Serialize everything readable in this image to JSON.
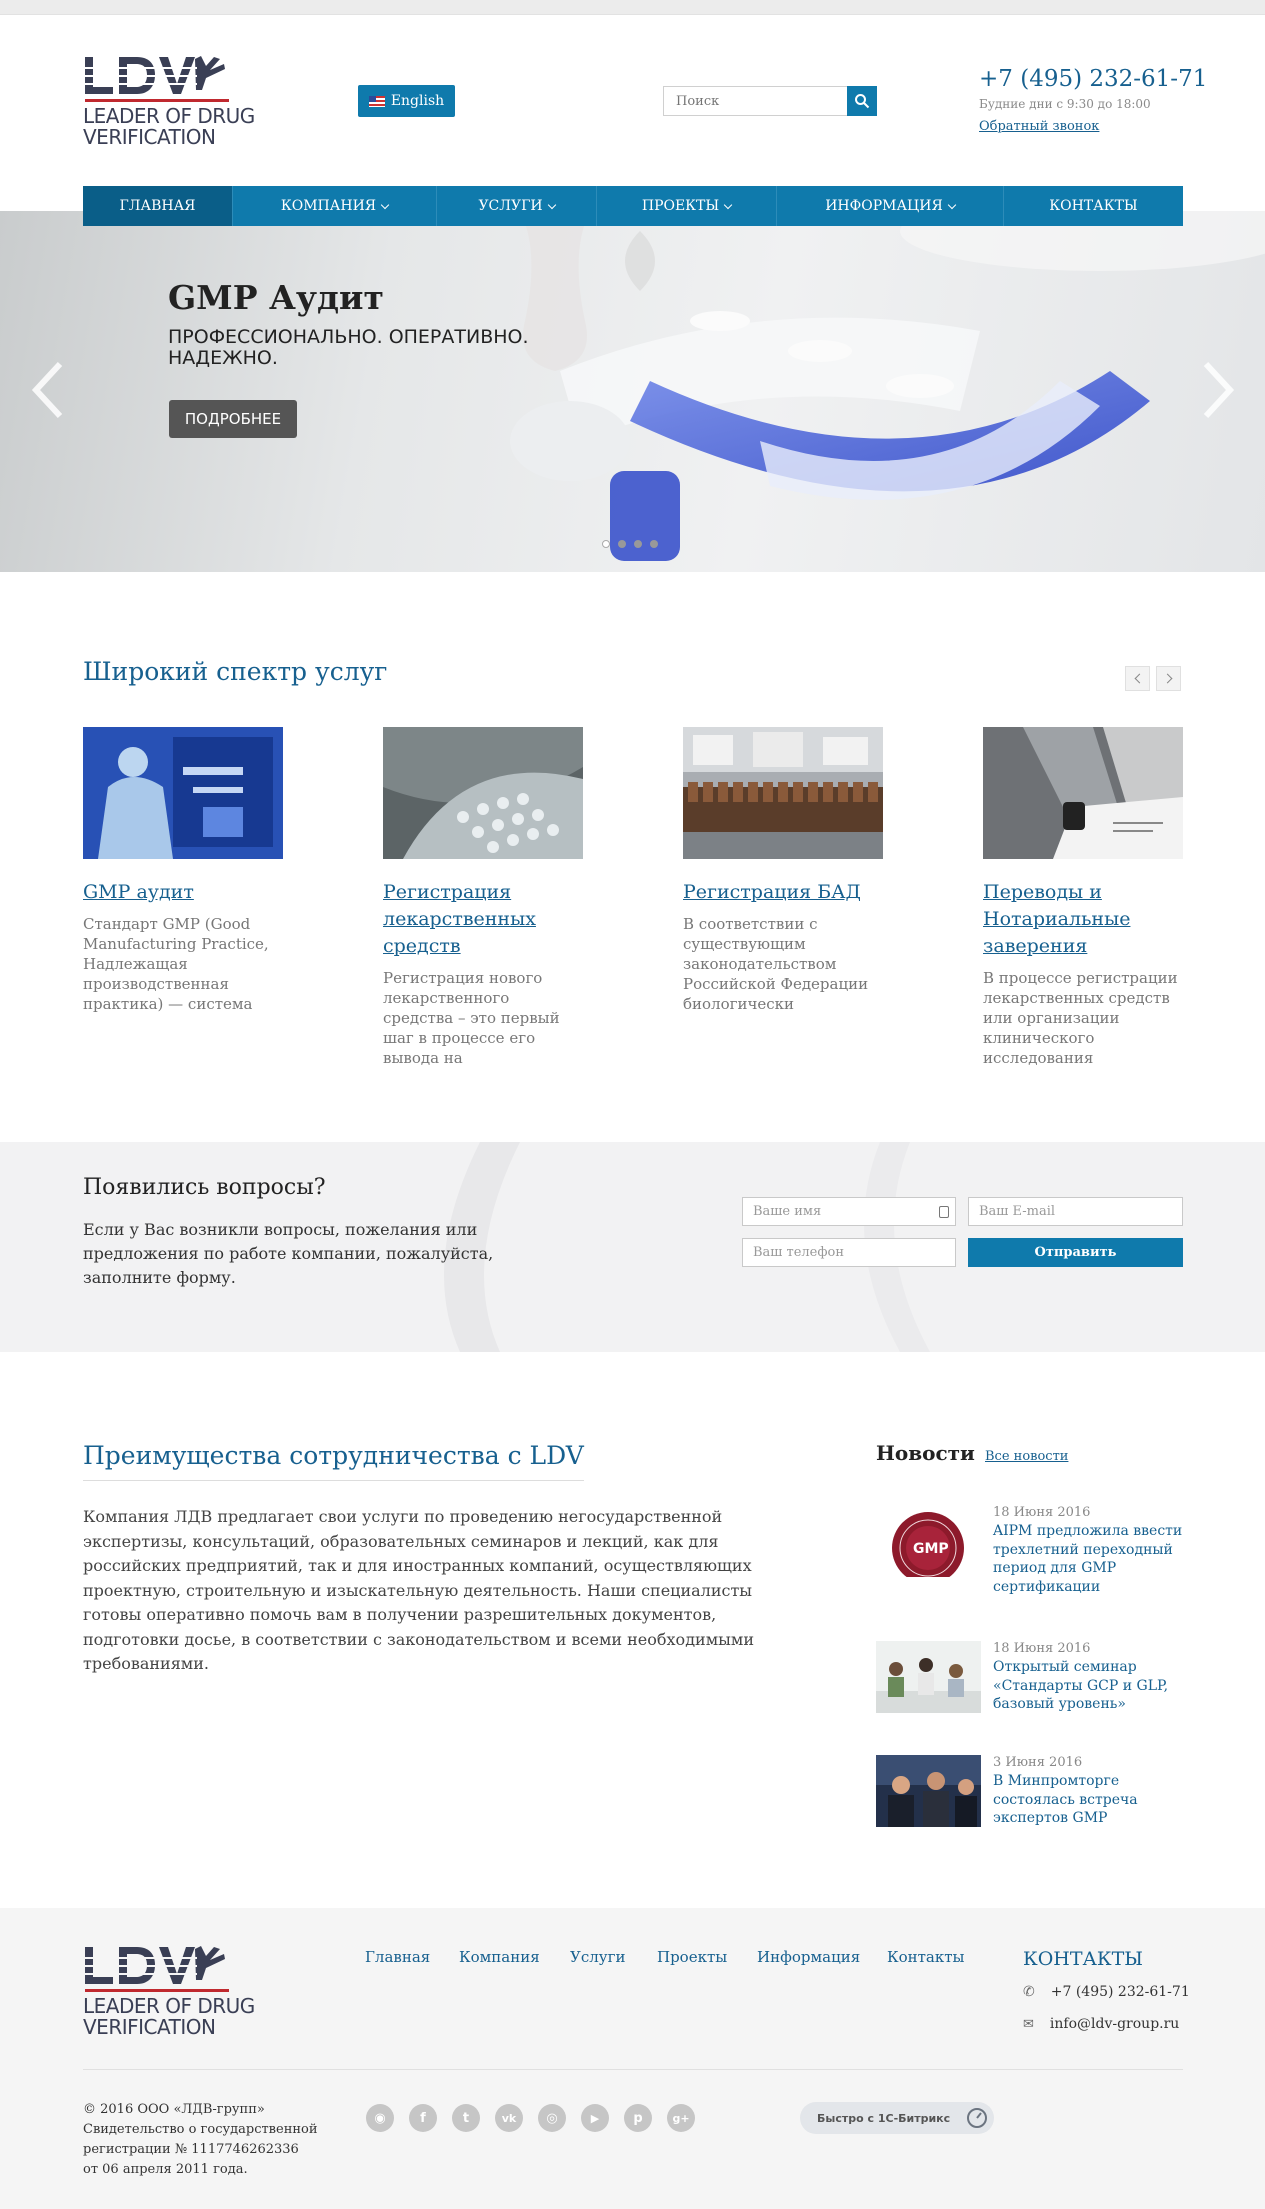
{
  "header": {
    "logo_line1": "LEADER OF DRUG",
    "logo_line2": "VERIFICATION",
    "language_label": "English",
    "search_placeholder": "Поиск",
    "phone": "+7 (495) 232-61-71",
    "hours": "Будние дни с 9:30 до 18:00",
    "callback": "Обратный звонок"
  },
  "nav": {
    "items": [
      {
        "label": "ГЛАВНАЯ",
        "active": true
      },
      {
        "label": "КОМПАНИЯ",
        "dropdown": true
      },
      {
        "label": "УСЛУГИ",
        "dropdown": true
      },
      {
        "label": "ПРОЕКТЫ",
        "dropdown": true
      },
      {
        "label": "ИНФОРМАЦИЯ",
        "dropdown": true
      },
      {
        "label": "КОНТАКТЫ"
      }
    ]
  },
  "hero": {
    "title": "GMP Аудит",
    "subtitle": "ПРОФЕССИОНАЛЬНО. ОПЕРАТИВНО. НАДЕЖНО.",
    "button": "ПОДРОБНЕЕ",
    "slide_count": 4,
    "active_slide": 1
  },
  "services": {
    "title": "Широкий спектр услуг",
    "cards": [
      {
        "title": "GMP аудит",
        "text": "Стандарт GMP (Good Manufacturing Practice, Надлежащая производственная практика) — система"
      },
      {
        "title": "Регистрация лекарственных средств",
        "text": "Регистрация нового лекарственного средства – это первый шаг в процессе его вывода на фармацевтический"
      },
      {
        "title": "Регистрация БАД",
        "text": "В соответствии с существующим законодательством Российской Федерации биологически"
      },
      {
        "title": "Переводы и Нотариальные заверения",
        "text": "В процессе регистрации лекарственных средств или организации клинического исследования"
      }
    ]
  },
  "questions": {
    "title": "Появились вопросы?",
    "text": "Если у Вас возникли вопросы, пожелания или предложения по работе компании, пожалуйста, заполните форму.",
    "name_placeholder": "Ваше имя",
    "email_placeholder": "Ваш E-mail",
    "phone_placeholder": "Ваш телефон",
    "submit": "Отправить"
  },
  "advantages": {
    "title": "Преимущества сотрудничества с LDV",
    "text": "Компания ЛДВ предлагает свои услуги по проведению негосударственной экспертизы, консультаций, образовательных семинаров и лекций, как для российских предприятий, так и для иностранных компаний, осуществляющих проектную, строительную и изыскательную деятельность. Наши специалисты готовы оперативно помочь вам в получении разрешительных документов, подготовки досье, в соответствии с законодательством и всеми необходимыми требованиями."
  },
  "news": {
    "title": "Новости",
    "all_link": "Все новости",
    "items": [
      {
        "date": "18 Июня 2016",
        "title": "AIPM предложила ввести трехлетний переходный период для GMP сертификации"
      },
      {
        "date": "18 Июня 2016",
        "title": "Открытый семинар «Стандарты GCP и GLP, базовый уровень»"
      },
      {
        "date": "3 Июня 2016",
        "title": "В Минпромторге состоялась встреча экспертов GMP"
      }
    ],
    "seal_text": "GMP"
  },
  "footer": {
    "nav": [
      "Главная",
      "Компания",
      "Услуги",
      "Проекты",
      "Информация",
      "Контакты"
    ],
    "contacts_title": "КОНТАКТЫ",
    "phone": "+7 (495) 232-61-71",
    "email": "info@ldv-group.ru",
    "copyright_lines": [
      "© 2016 ООО «ЛДВ-групп»",
      "Свидетельство о государственной",
      "регистрации № 1117746262336",
      "от 06 апреля 2011 года."
    ],
    "social": [
      {
        "name": "rss-icon",
        "glyph": "◉"
      },
      {
        "name": "facebook-icon",
        "glyph": "f"
      },
      {
        "name": "twitter-icon",
        "glyph": "t"
      },
      {
        "name": "vk-icon",
        "glyph": "vk"
      },
      {
        "name": "instagram-icon",
        "glyph": "◎"
      },
      {
        "name": "youtube-icon",
        "glyph": "▶"
      },
      {
        "name": "pinterest-icon",
        "glyph": "p"
      },
      {
        "name": "google-plus-icon",
        "glyph": "g+"
      }
    ],
    "bitrix_label": "Быстро с 1С-Битрикс"
  },
  "colors": {
    "brand_blue": "#0f7aac",
    "link_blue": "#17608f",
    "logo_red": "#c0292f",
    "logo_navy": "#3a3f55"
  }
}
